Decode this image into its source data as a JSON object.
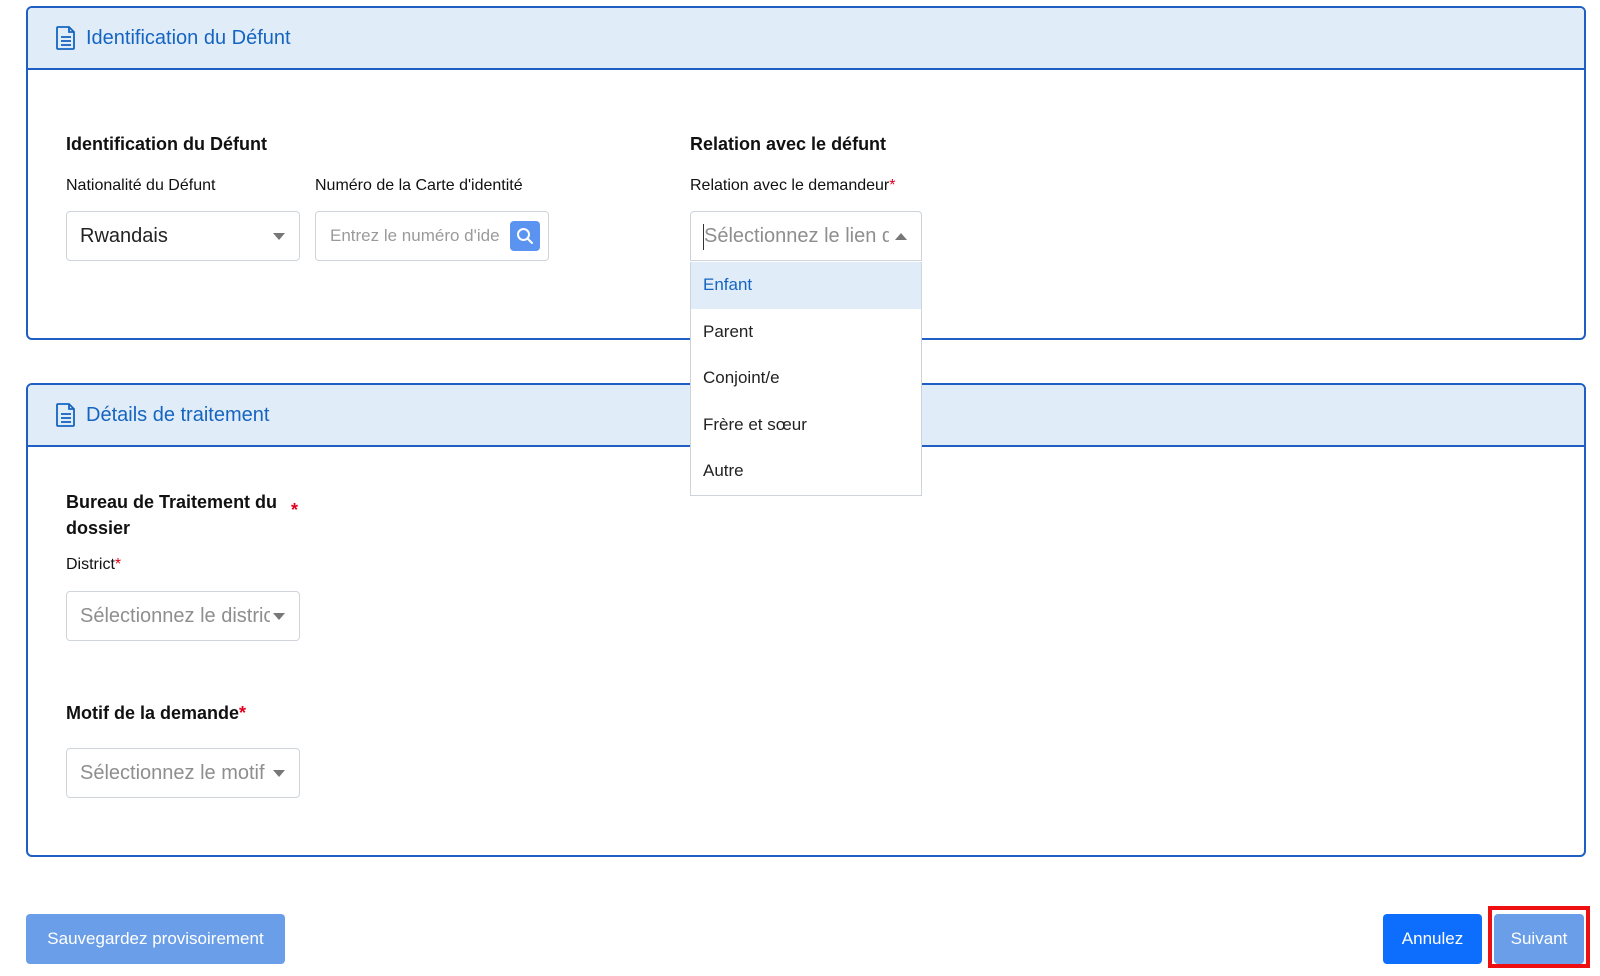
{
  "card1": {
    "header_title": "Identification du Défunt",
    "section_left_title": "Identification du Défunt",
    "nationality_label": "Nationalité du Défunt",
    "nationality_value": "Rwandais",
    "id_label": "Numéro de la Carte d'identité",
    "id_placeholder": "Entrez le numéro d'identité",
    "section_right_title": "Relation avec le défunt",
    "relation_label": "Relation avec le demandeur",
    "relation_required": "*",
    "relation_placeholder": "Sélectionnez le lien de parenté",
    "relation_options": [
      "Enfant",
      "Parent",
      "Conjoint/e",
      "Frère et sœur",
      "Autre"
    ],
    "relation_highlighted_option": "Enfant"
  },
  "card2": {
    "header_title": "Détails de traitement",
    "office_title": "Bureau de Traitement du dossier",
    "office_required": "*",
    "district_label": "District",
    "district_required": "*",
    "district_placeholder": "Sélectionnez le district",
    "motif_title": "Motif de la demande",
    "motif_required": "*",
    "motif_placeholder": "Sélectionnez le motif"
  },
  "footer": {
    "save_label": "Sauvegardez provisoirement",
    "cancel_label": "Annulez",
    "next_label": "Suivant"
  },
  "icons": {
    "header_icon": "document-icon",
    "search_icon": "search-icon"
  },
  "colors": {
    "accent": "#1565c0",
    "header_bg": "#e1ecf9",
    "primary_button": "#0d6efd",
    "light_button": "#6a9ee8",
    "required": "#e0001b",
    "highlight": "#ee1010"
  }
}
